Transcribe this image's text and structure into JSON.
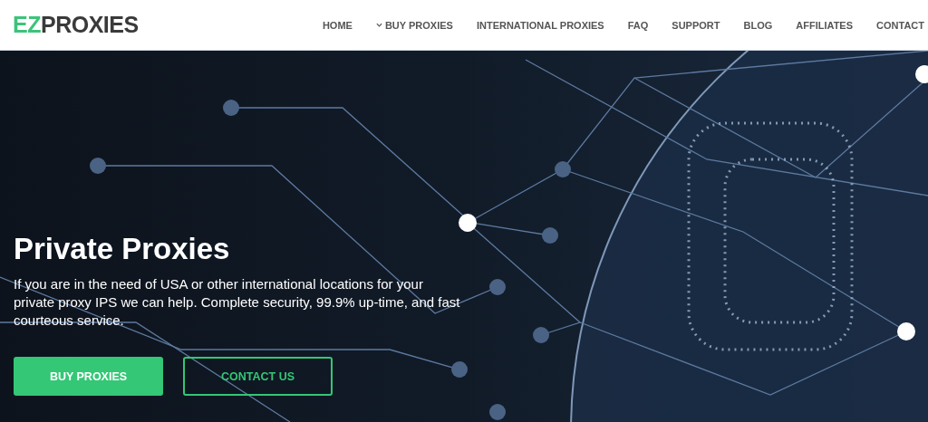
{
  "header": {
    "logo": {
      "accent": "EZ",
      "text": "PROXIES"
    },
    "nav": [
      {
        "label": "HOME",
        "has_dropdown": false
      },
      {
        "label": "BUY PROXIES",
        "has_dropdown": true
      },
      {
        "label": "INTERNATIONAL PROXIES",
        "has_dropdown": false
      },
      {
        "label": "FAQ",
        "has_dropdown": false
      },
      {
        "label": "SUPPORT",
        "has_dropdown": false
      },
      {
        "label": "BLOG",
        "has_dropdown": false
      },
      {
        "label": "AFFILIATES",
        "has_dropdown": false
      },
      {
        "label": "CONTACT",
        "has_dropdown": false
      }
    ]
  },
  "hero": {
    "title": "Private Proxies",
    "text": "If you are in the need of USA or other international locations for your private proxy IPS we can help. Complete security, 99.9% up-time, and fast courteous service.",
    "buttons": [
      {
        "label": "BUY PROXIES",
        "kind": "primary"
      },
      {
        "label": "CONTACT US",
        "kind": "outline"
      }
    ]
  }
}
